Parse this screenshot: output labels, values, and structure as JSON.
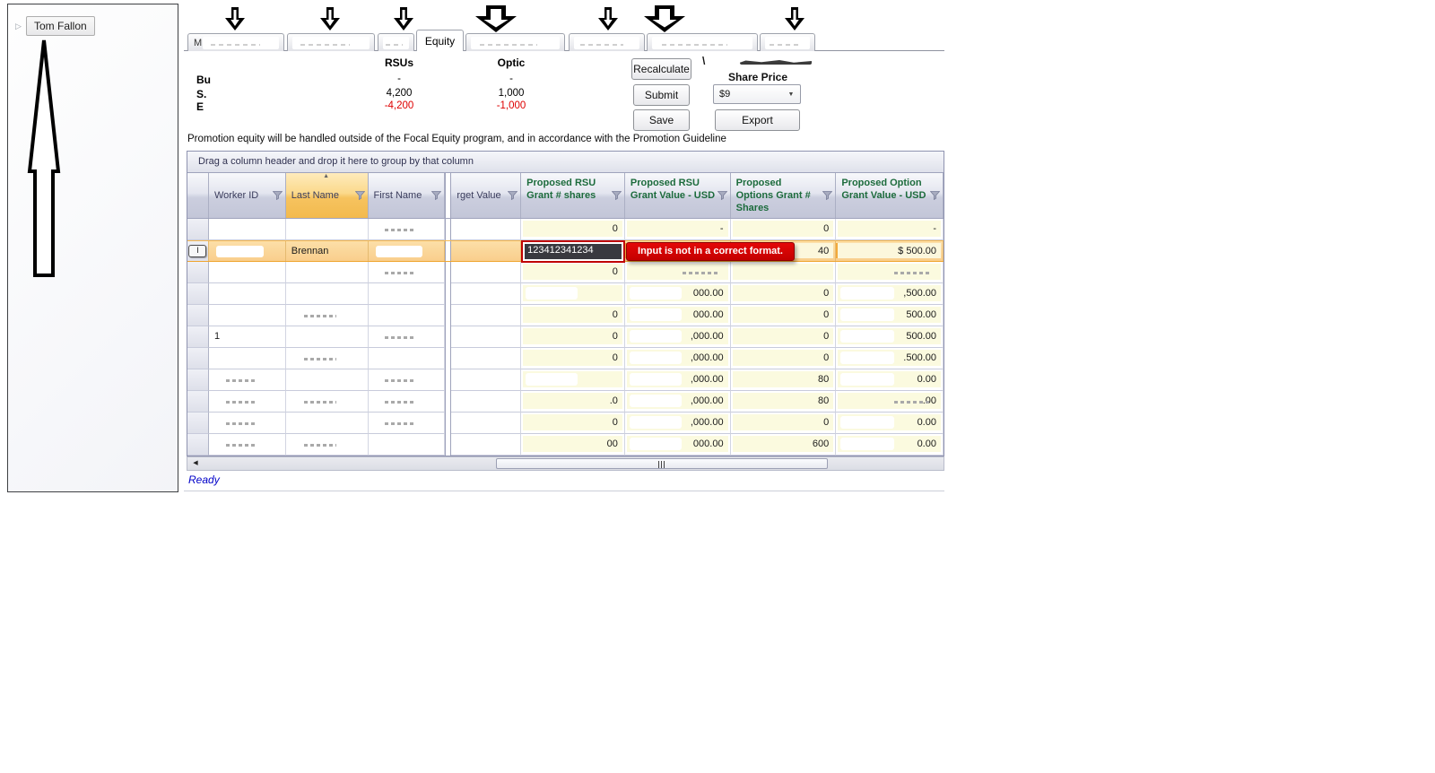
{
  "left_panel": {
    "tree_item_label": "Tom Fallon"
  },
  "tabs": [
    {
      "label": "M",
      "redacted": true,
      "selected": false
    },
    {
      "label": "",
      "redacted": true,
      "selected": false
    },
    {
      "label": "",
      "redacted": true,
      "selected": false
    },
    {
      "label": "Equity",
      "redacted": false,
      "selected": true
    },
    {
      "label": "",
      "redacted": true,
      "selected": false
    },
    {
      "label": "",
      "redacted": true,
      "selected": false
    },
    {
      "label": "",
      "redacted": true,
      "selected": false
    },
    {
      "label": "",
      "redacted": true,
      "selected": false
    }
  ],
  "summary": {
    "col_rsus": "RSUs",
    "col_options": "Optic",
    "rows": [
      {
        "label": "Bu",
        "rsus": "-",
        "options": "-",
        "negative": false
      },
      {
        "label": "S.",
        "rsus": "4,200",
        "options": "1,000",
        "negative": false
      },
      {
        "label": "E",
        "rsus": "-4,200",
        "options": "-1,000",
        "negative": true
      }
    ]
  },
  "toolbar": {
    "recalculate_label": "Recalculate",
    "submit_label": "Submit",
    "save_label": "Save",
    "export_label": "Export",
    "share_price_label": "Share Price",
    "share_price_value": "$9"
  },
  "notice_text": "Promotion equity will be handled outside of the Focal Equity program, and in accordance with the Promotion Guideline",
  "grid": {
    "group_bar_text": "Drag a column header and drop it here to group by that column",
    "columns": [
      {
        "label": "Worker ID",
        "filter": true,
        "sorted": false,
        "green": false
      },
      {
        "label": "Last Name",
        "filter": true,
        "sorted": true,
        "green": false
      },
      {
        "label": "First Name",
        "filter": true,
        "sorted": false,
        "green": false
      },
      {
        "label": "rget Value",
        "filter": true,
        "sorted": false,
        "green": false
      },
      {
        "label": "Proposed RSU Grant # shares",
        "filter": true,
        "sorted": false,
        "green": true
      },
      {
        "label": "Proposed RSU Grant Value - USD",
        "filter": true,
        "sorted": false,
        "green": true
      },
      {
        "label": "Proposed Options Grant # Shares",
        "filter": true,
        "sorted": false,
        "green": true
      },
      {
        "label": "Proposed Option Grant Value - USD",
        "filter": true,
        "sorted": false,
        "green": true
      }
    ],
    "edit_cell_value": "123412341234",
    "error_tooltip": "Input is not in a correct format.",
    "rows": [
      {
        "worker": "",
        "last": "",
        "first": "",
        "target": "",
        "rsu_shares": "0",
        "rsu_value": "-",
        "opt_shares": "0",
        "opt_value": "-",
        "selected": false,
        "editing": false,
        "marks": {
          "first": "g"
        }
      },
      {
        "worker": "",
        "last": "Brennan",
        "first": "",
        "target": "",
        "rsu_shares": "",
        "rsu_value": "",
        "opt_shares": "40",
        "opt_value": "$ 500.00",
        "selected": true,
        "editing": true,
        "marks": {
          "worker": "w",
          "first": "w"
        }
      },
      {
        "worker": "",
        "last": "",
        "first": "",
        "target": "",
        "rsu_shares": "0",
        "rsu_value": "",
        "opt_shares": "",
        "opt_value": "",
        "selected": false,
        "editing": false,
        "marks": {
          "rsu_value": "g",
          "opt_value": "g",
          "first": "g"
        }
      },
      {
        "worker": "",
        "last": "",
        "first": "",
        "target": "",
        "rsu_shares": "",
        "rsu_value": "000.00",
        "opt_shares": "0",
        "opt_value": ",500.00",
        "selected": false,
        "editing": false,
        "marks": {
          "rsu_shares": "w",
          "rsu_value": "w",
          "opt_value": "w"
        }
      },
      {
        "worker": "",
        "last": "",
        "first": "",
        "target": "",
        "rsu_shares": "0",
        "rsu_value": "000.00",
        "opt_shares": "0",
        "opt_value": "500.00",
        "selected": false,
        "editing": false,
        "marks": {
          "rsu_value": "w",
          "opt_value": "w",
          "last": "g"
        }
      },
      {
        "worker": "1",
        "last": "",
        "first": "",
        "target": "",
        "rsu_shares": "0",
        "rsu_value": ",000.00",
        "opt_shares": "0",
        "opt_value": "500.00",
        "selected": false,
        "editing": false,
        "marks": {
          "rsu_value": "w",
          "opt_value": "w",
          "first": "g"
        }
      },
      {
        "worker": "",
        "last": "",
        "first": "",
        "target": "",
        "rsu_shares": "0",
        "rsu_value": ",000.00",
        "opt_shares": "0",
        "opt_value": ".500.00",
        "selected": false,
        "editing": false,
        "marks": {
          "rsu_value": "w",
          "opt_value": "w",
          "last": "g"
        }
      },
      {
        "worker": "",
        "last": "",
        "first": "",
        "target": "",
        "rsu_shares": "",
        "rsu_value": ",000.00",
        "opt_shares": "80",
        "opt_value": "0.00",
        "selected": false,
        "editing": false,
        "marks": {
          "rsu_shares": "w",
          "rsu_value": "w",
          "opt_value": "w",
          "worker": "g",
          "first": "g"
        }
      },
      {
        "worker": "",
        "last": "",
        "first": "",
        "target": "",
        "rsu_shares": ".0",
        "rsu_value": ",000.00",
        "opt_shares": "80",
        "opt_value": ".00",
        "selected": false,
        "editing": false,
        "marks": {
          "rsu_value": "w",
          "opt_value": "g",
          "worker": "g",
          "last": "g",
          "first": "g"
        }
      },
      {
        "worker": "",
        "last": "",
        "first": "",
        "target": "",
        "rsu_shares": "0",
        "rsu_value": ",000.00",
        "opt_shares": "0",
        "opt_value": "0.00",
        "selected": false,
        "editing": false,
        "marks": {
          "rsu_value": "w",
          "opt_value": "w",
          "worker": "g",
          "first": "g"
        }
      },
      {
        "worker": "",
        "last": "",
        "first": "",
        "target": "",
        "rsu_shares": "00",
        "rsu_value": "000.00",
        "opt_shares": "600",
        "opt_value": "0.00",
        "selected": false,
        "editing": false,
        "marks": {
          "rsu_value": "w",
          "opt_value": "w",
          "worker": "g",
          "last": "g"
        }
      }
    ]
  },
  "statusbar": {
    "ready_text": "Ready"
  },
  "colors": {
    "selected_row_orange": "#FBD79E",
    "editable_cell_yellow": "#FBFADF",
    "error_red": "#D40000",
    "header_green": "#1C6B3C",
    "sorted_header_orange": "#F6C35F",
    "status_blue": "#0000C8",
    "negative_red": "#DE0000"
  }
}
